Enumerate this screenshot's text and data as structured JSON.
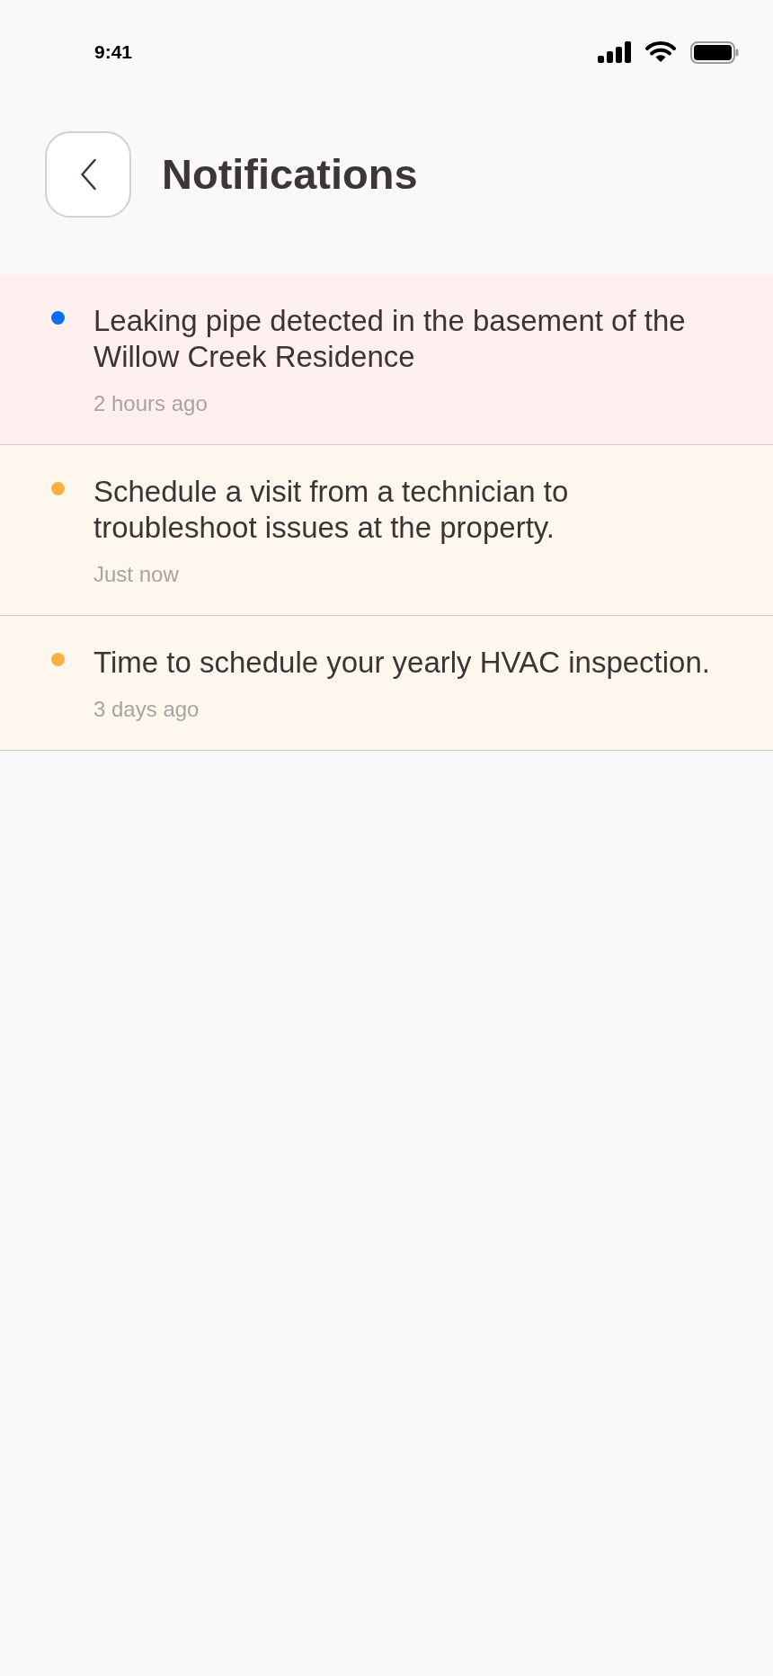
{
  "status_bar": {
    "time": "9:41"
  },
  "header": {
    "title": "Notifications"
  },
  "notifications": [
    {
      "kind": "alert",
      "color": "#0a6cf0",
      "message": "Leaking pipe detected in the basement of the Willow Creek Residence",
      "time": "2 hours ago"
    },
    {
      "kind": "reminder",
      "color": "#fbb040",
      "message": "Schedule a visit from a technician to troubleshoot issues at the property.",
      "time": "Just now"
    },
    {
      "kind": "reminder",
      "color": "#fbb040",
      "message": "Time to schedule your yearly HVAC inspection.",
      "time": "3 days ago"
    }
  ]
}
